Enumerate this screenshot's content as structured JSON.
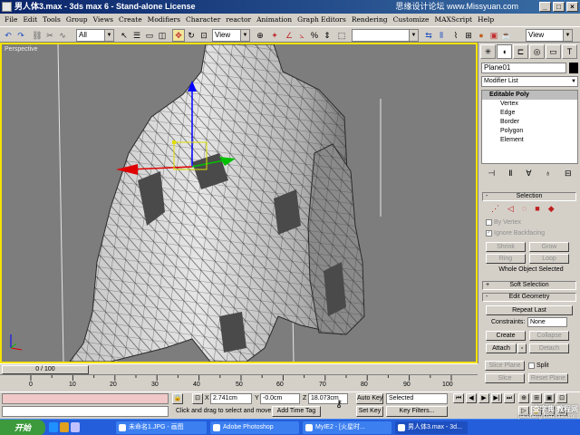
{
  "window": {
    "title": "男人体3.max - 3ds max 6 - Stand-alone License",
    "watermark": "思缘设计论坛 www.Missyuan.com",
    "controls": [
      "_",
      "□",
      "×"
    ]
  },
  "menu": [
    "File",
    "Edit",
    "Tools",
    "Group",
    "Views",
    "Create",
    "Modifiers",
    "Character",
    "reactor",
    "Animation",
    "Graph Editors",
    "Rendering",
    "Customize",
    "MAXScript",
    "Help"
  ],
  "toolbar": {
    "selection_filter": "All",
    "ref_coord": "View",
    "named_selection": "",
    "render_view": "View"
  },
  "viewport": {
    "label": "Perspective",
    "colors": {
      "background": "#7d7d7d",
      "border": "#f5e200",
      "mesh": "#d8d8d8",
      "wire": "#3a3a3a"
    }
  },
  "command_panel": {
    "tabs": [
      "create-icon",
      "modify-icon",
      "hierarchy-icon",
      "motion-icon",
      "display-icon",
      "utilities-icon"
    ],
    "object_name": "Plane01",
    "modifier_list": "Modifier List",
    "stack": {
      "main": "Editable Poly",
      "subs": [
        "Vertex",
        "Edge",
        "Border",
        "Polygon",
        "Element"
      ]
    },
    "selection": {
      "title": "Selection",
      "by_vertex": "By Vertex",
      "ignore_backfacing": "Ignore Backfacing",
      "shrink": "Shrink",
      "grow": "Grow",
      "ring": "Ring",
      "loop": "Loop",
      "status": "Whole Object Selected"
    },
    "soft_selection": {
      "title": "Soft Selection"
    },
    "edit_geometry": {
      "title": "Edit Geometry",
      "repeat_last": "Repeat Last",
      "constraints_label": "Constraints:",
      "constraints_value": "None",
      "create": "Create",
      "collapse": "Collapse",
      "attach": "Attach",
      "detach": "Detach",
      "slice_plane": "Slice Plane",
      "split": "Split",
      "slice": "Slice",
      "reset_plane": "Reset Plane"
    }
  },
  "timeline": {
    "slider": "0 / 100",
    "ticks": [
      "0",
      "10",
      "20",
      "30",
      "40",
      "50",
      "60",
      "70",
      "80",
      "90",
      "100"
    ]
  },
  "status": {
    "prompt": "Click and drag to select and move",
    "add_time_tag": "Add Time Tag",
    "x_label": "X",
    "x": "2.741cm",
    "y_label": "Y",
    "y": "-0.0cm",
    "z_label": "Z",
    "z": "18.073cm",
    "auto_key": "Auto Key",
    "set_key": "Set Key",
    "key_mode": "Selected",
    "key_filters": "Key Filters..."
  },
  "taskbar": {
    "start": "开始",
    "tasks": [
      "未命名1.JPG - 画图",
      "Adobe Photoshop",
      "MyIE2 - [火星时...",
      "男人体3.max - 3d..."
    ],
    "site_watermark": "查字典 教程网",
    "site_url": "jiaocheng.chazidian.com"
  }
}
